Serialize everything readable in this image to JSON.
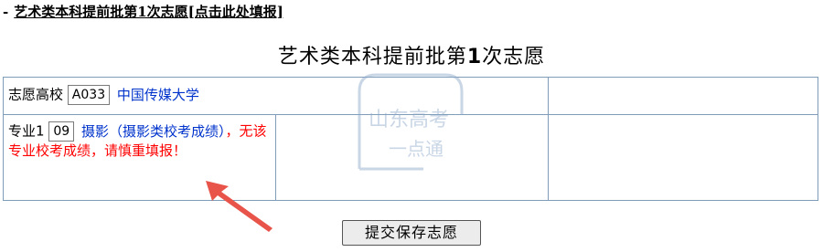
{
  "top_link": {
    "prefix": "-",
    "text": "艺术类本科提前批第1次志愿[点击此处填报]"
  },
  "title": {
    "part1": "艺术类本科提前批第",
    "number": "1",
    "part2": "次志愿"
  },
  "row1": {
    "label": "志愿高校",
    "code": "A033",
    "school": "中国传媒大学"
  },
  "row2": {
    "label": "专业1",
    "code": "09",
    "major": "摄影（摄影类校考成绩）",
    "warning": "，无该专业校考成绩，请慎重填报！"
  },
  "submit_button": "提交保存志愿",
  "watermark": "山东高考一点通",
  "colors": {
    "border": "#7f9db9",
    "school_text": "#0033cc",
    "warning_text": "#ff0000",
    "arrow": "#e8534a"
  }
}
